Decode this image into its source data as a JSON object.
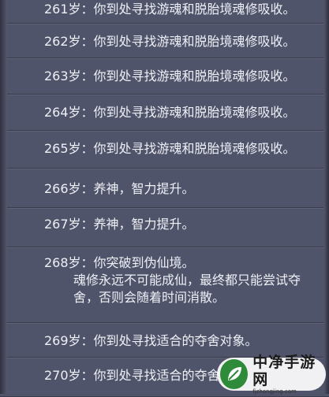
{
  "entries": [
    {
      "age": "261岁：",
      "text": "你到处寻找游魂和脱胎境魂修吸收。"
    },
    {
      "age": "262岁：",
      "text": "你到处寻找游魂和脱胎境魂修吸收。"
    },
    {
      "age": "263岁：",
      "text": "你到处寻找游魂和脱胎境魂修吸收。"
    },
    {
      "age": "264岁：",
      "text": "你到处寻找游魂和脱胎境魂修吸收。"
    },
    {
      "age": "265岁：",
      "text": "你到处寻找游魂和脱胎境魂修吸收。"
    },
    {
      "age": "266岁：",
      "text": "养神，智力提升。"
    },
    {
      "age": "267岁：",
      "text": "养神，智力提升。"
    },
    {
      "age": "268岁：",
      "text": "你突破到伪仙境。",
      "line2": "魂修永远不可能成仙，最终都只能尝试夺",
      "line3": "舍，否则会随着时间消散。"
    },
    {
      "age": "269岁：",
      "text": "你到处寻找适合的夺舍对象。"
    },
    {
      "age": "270岁：",
      "text": "你到处寻找适合的夺舍对象。"
    }
  ],
  "watermark": {
    "title": "中净手游网",
    "url": "fjzhongjing.com",
    "logo_icon": "leaf-icon"
  }
}
